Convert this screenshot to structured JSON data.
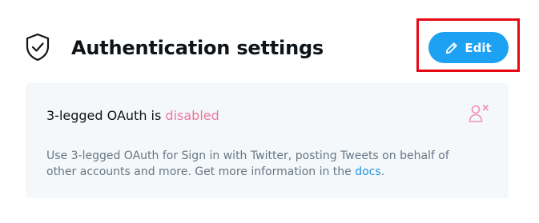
{
  "header": {
    "icon": "shield-check-icon",
    "title": "Authentication settings"
  },
  "edit_button": {
    "label": "Edit",
    "icon": "pencil-icon",
    "color": "#1da1f2",
    "highlight_color": "#e50914"
  },
  "oauth_card": {
    "status_prefix": "3-legged OAuth is",
    "status_value": "disabled",
    "status_color": "#e0245e",
    "status_icon": "user-x-icon",
    "description_text": "Use 3-legged OAuth for Sign in with Twitter, posting Tweets on behalf of other accounts and more. Get more information in the",
    "link_text": "docs",
    "link_suffix": "."
  }
}
